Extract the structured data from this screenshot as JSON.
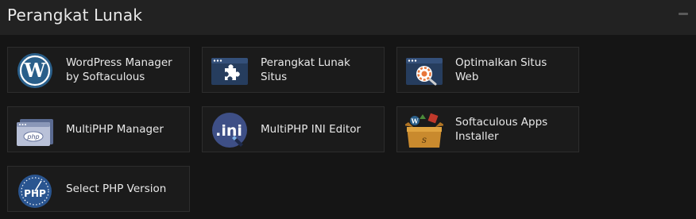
{
  "panel": {
    "title": "Perangkat Lunak"
  },
  "tiles": [
    {
      "label": "WordPress Manager by Softaculous",
      "icon": "wordpress-icon"
    },
    {
      "label": "Perangkat Lunak Situs",
      "icon": "puzzle-piece-icon"
    },
    {
      "label": "Optimalkan Situs Web",
      "icon": "website-optimization-icon"
    },
    {
      "label": "MultiPHP Manager",
      "icon": "php-window-icon"
    },
    {
      "label": "MultiPHP INI Editor",
      "icon": "ini-editor-icon"
    },
    {
      "label": "Softaculous Apps Installer",
      "icon": "softaculous-box-icon"
    },
    {
      "label": "Select PHP Version",
      "icon": "php-gauge-icon"
    }
  ],
  "colors": {
    "background": "#151515",
    "header": "#222222",
    "tile": "#1b1b1b",
    "tile_border": "#2d2d2d",
    "icon_navy": "#263d5e",
    "accent_orange": "#e8763a"
  }
}
